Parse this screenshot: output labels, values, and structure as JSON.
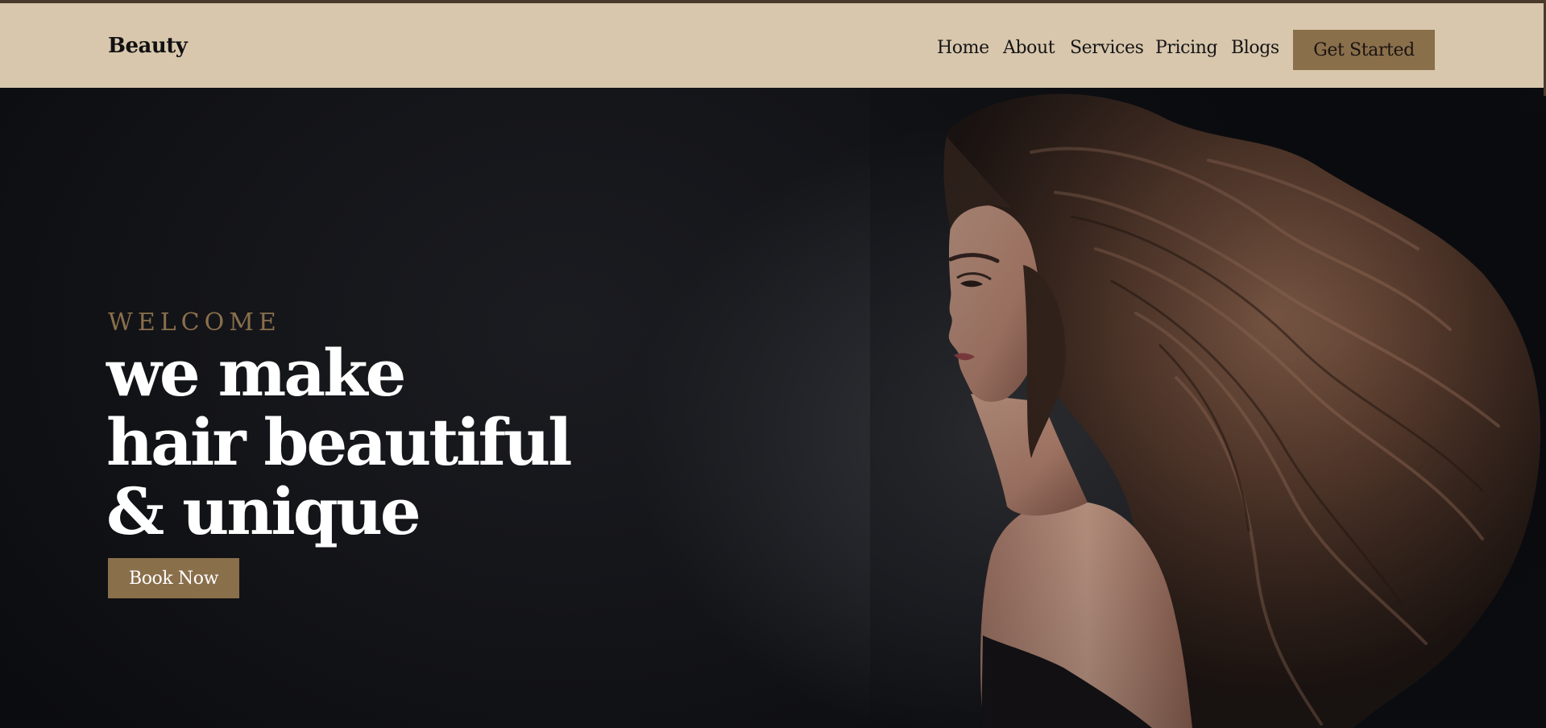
{
  "brand": {
    "logo": "Beauty"
  },
  "nav": {
    "links": [
      "Home",
      "About",
      "Services",
      "Pricing",
      "Blogs"
    ],
    "cta_label": "Get Started"
  },
  "hero": {
    "eyebrow": "WELCOME",
    "headline_lines": [
      "we make",
      "hair beautiful",
      "& unique"
    ],
    "button_label": "Book Now",
    "image": "woman-with-flowing-hair-photo"
  },
  "colors": {
    "header_bg": "#d8c7ad",
    "accent": "#8a6f4b",
    "hero_bg": "#0e0f13",
    "headline": "#ffffff"
  }
}
